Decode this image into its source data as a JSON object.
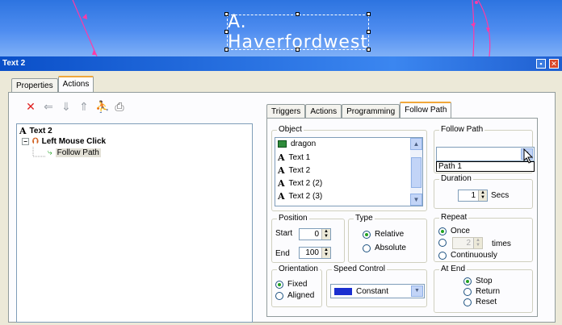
{
  "slide": {
    "title": "A. Haverfordwest",
    "background_color": "#3b7ee8"
  },
  "window": {
    "title": "Text 2",
    "minimize_glyph": "▪",
    "close_glyph": "✕"
  },
  "outer_tabs": [
    "Properties",
    "Actions"
  ],
  "toolbar": {
    "delete_glyph": "✕",
    "back_glyph": "⇐",
    "down_glyph": "⇓",
    "up_glyph": "⇑",
    "people_glyph": "⛹",
    "print_glyph": "⎙"
  },
  "tree": {
    "root": "Text 2",
    "event": "Left Mouse Click",
    "action": "Follow Path",
    "expander_glyph": "−"
  },
  "inner_tabs": [
    "Triggers",
    "Actions",
    "Programming",
    "Follow Path"
  ],
  "object_group": {
    "label": "Object",
    "items": [
      {
        "icon": "image-icon",
        "label": "dragon"
      },
      {
        "icon": "text-icon",
        "label": "Text 1"
      },
      {
        "icon": "text-icon",
        "label": "Text 2"
      },
      {
        "icon": "text-icon",
        "label": "Text 2 (2)"
      },
      {
        "icon": "text-icon",
        "label": "Text 2 (3)"
      }
    ],
    "text_glyph": "A"
  },
  "follow_path_group": {
    "label": "Follow Path",
    "selected": "",
    "dropdown_option": "Path 1"
  },
  "duration_group": {
    "label": "Duration",
    "value": "1",
    "unit": "Secs"
  },
  "position_group": {
    "label": "Position",
    "start_label": "Start",
    "start_value": "0",
    "end_label": "End",
    "end_value": "100"
  },
  "type_group": {
    "label": "Type",
    "options": [
      "Relative",
      "Absolute"
    ],
    "selected": "Relative"
  },
  "repeat_group": {
    "label": "Repeat",
    "once": "Once",
    "times_value": "2",
    "times": "times",
    "continuously": "Continuously",
    "selected": "Once"
  },
  "orientation_group": {
    "label": "Orientation",
    "options": [
      "Fixed",
      "Aligned"
    ],
    "selected": "Fixed"
  },
  "speed_group": {
    "label": "Speed Control",
    "value": "Constant",
    "swatch_color": "#1a2fd0"
  },
  "at_end_group": {
    "label": "At End",
    "options": [
      "Stop",
      "Return",
      "Reset"
    ],
    "selected": "Stop"
  },
  "icons": {
    "spin_up": "▲",
    "spin_down": "▼",
    "combo_arrow": "▼",
    "scroll_up": "▲",
    "scroll_down": "▼"
  }
}
